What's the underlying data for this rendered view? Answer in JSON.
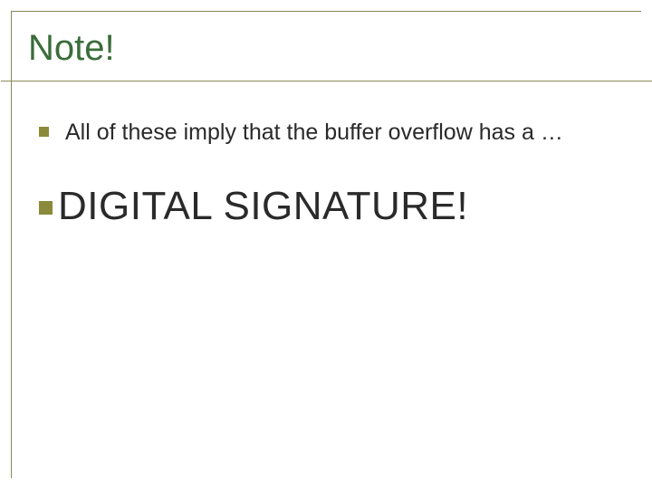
{
  "slide": {
    "title": "Note!",
    "bullets": [
      {
        "text": "All of these imply that the buffer overflow has a …",
        "size": "normal"
      },
      {
        "text": "DIGITAL SIGNATURE!",
        "size": "large"
      }
    ]
  }
}
